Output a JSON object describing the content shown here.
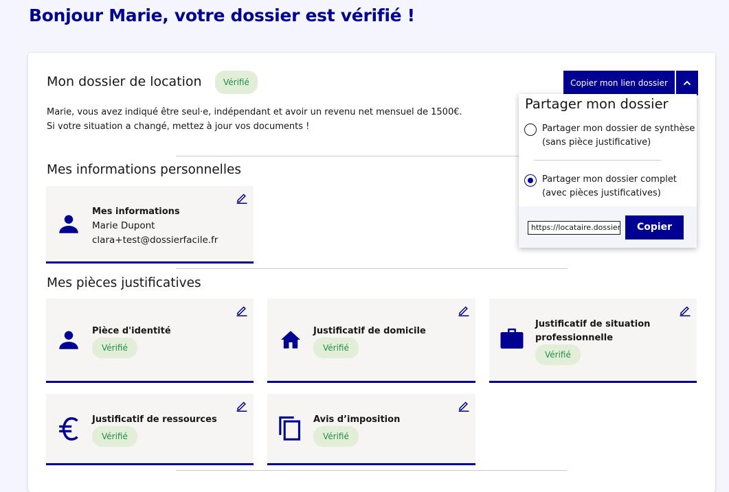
{
  "greeting": "Bonjour Marie, votre dossier est vérifié !",
  "dossier": {
    "title": "Mon dossier de location",
    "status": "Vérifié",
    "intro_line1": "Marie, vous avez indiqué être seul·e, indépendant et avoir un revenu net mensuel de 1500€.",
    "intro_line2": "Si votre situation a changé, mettez à jour vos documents !"
  },
  "share": {
    "copy_link_label": "Copier mon lien dossier",
    "dropdown_title": "Partager mon dossier",
    "option_summary_line1": "Partager mon dossier de synthèse",
    "option_summary_line2": "(sans pièce justificative)",
    "option_full_line1": "Partager mon dossier complet",
    "option_full_line2": "(avec pièces justificatives)",
    "selected_option": "full",
    "link_value": "https://locataire.dossierfacile",
    "copy_button": "Copier"
  },
  "personal": {
    "section_title": "Mes informations personnelles",
    "card_title": "Mes informations",
    "name": "Marie Dupont",
    "email": "clara+test@dossierfacile.fr"
  },
  "documents": {
    "section_title": "Mes pièces justificatives",
    "items": [
      {
        "title": "Pièce d'identité",
        "status": "Vérifié",
        "icon": "person-icon"
      },
      {
        "title": "Justificatif de domicile",
        "status": "Vérifié",
        "icon": "home-icon"
      },
      {
        "title_line1": "Justificatif de situation",
        "title_line2": "professionnelle",
        "status": "Vérifié",
        "icon": "briefcase-icon"
      },
      {
        "title": "Justificatif de ressources",
        "status": "Vérifié",
        "icon": "euro-icon"
      },
      {
        "title": "Avis d’imposition",
        "status": "Vérifié",
        "icon": "copy-documents-icon"
      }
    ]
  },
  "colors": {
    "primary": "#000091",
    "badge_bg": "#e3eed8",
    "badge_text": "#1f8d49",
    "card_bg": "#f6f5f3"
  }
}
